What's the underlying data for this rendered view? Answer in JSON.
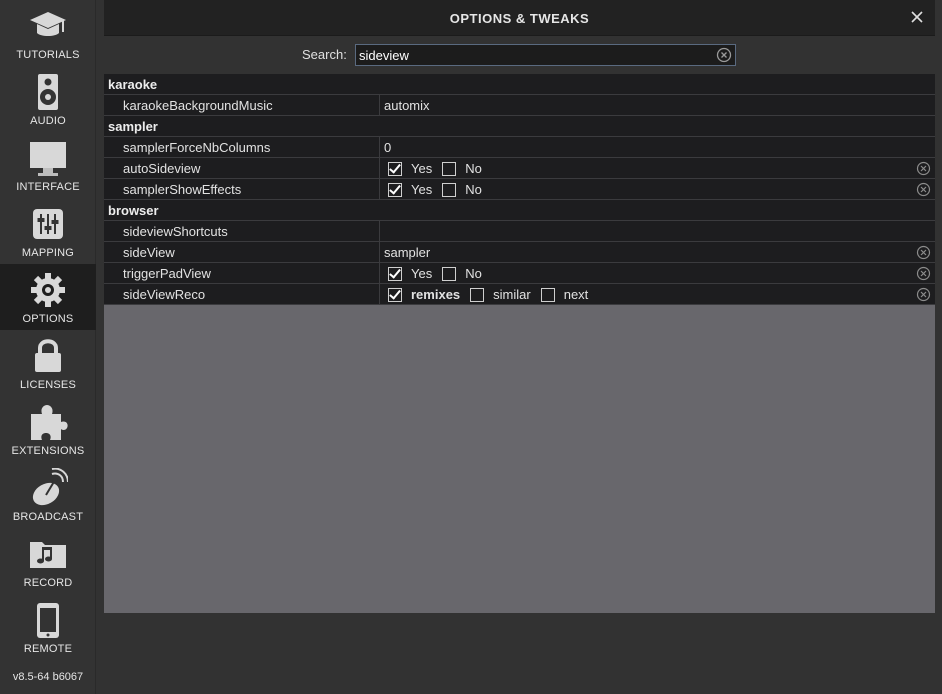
{
  "sidebar": {
    "items": [
      {
        "label": "TUTORIALS",
        "icon": "graduation-cap-icon"
      },
      {
        "label": "AUDIO",
        "icon": "speaker-icon"
      },
      {
        "label": "INTERFACE",
        "icon": "monitor-icon"
      },
      {
        "label": "MAPPING",
        "icon": "sliders-icon"
      },
      {
        "label": "OPTIONS",
        "icon": "gear-icon",
        "active": true
      },
      {
        "label": "LICENSES",
        "icon": "lock-icon"
      },
      {
        "label": "EXTENSIONS",
        "icon": "puzzle-icon"
      },
      {
        "label": "BROADCAST",
        "icon": "satellite-dish-icon"
      },
      {
        "label": "RECORD",
        "icon": "music-folder-icon"
      },
      {
        "label": "REMOTE",
        "icon": "phone-icon"
      }
    ],
    "version": "v8.5-64 b6067"
  },
  "window": {
    "title": "OPTIONS & TWEAKS",
    "close_icon": "close-icon"
  },
  "search": {
    "label": "Search:",
    "value": "sideview",
    "clear_icon": "clear-circle-icon"
  },
  "groups": [
    {
      "name": "karaoke",
      "rows": [
        {
          "key": "karaokeBackgroundMusic",
          "type": "text",
          "value": "automix",
          "reset": false
        }
      ]
    },
    {
      "name": "sampler",
      "rows": [
        {
          "key": "samplerForceNbColumns",
          "type": "text",
          "value": "0",
          "reset": false
        },
        {
          "key": "autoSideview",
          "type": "choice",
          "options": [
            {
              "label": "Yes",
              "checked": true
            },
            {
              "label": "No",
              "checked": false
            }
          ],
          "reset": true
        },
        {
          "key": "samplerShowEffects",
          "type": "choice",
          "options": [
            {
              "label": "Yes",
              "checked": true
            },
            {
              "label": "No",
              "checked": false
            }
          ],
          "reset": true
        }
      ]
    },
    {
      "name": "browser",
      "rows": [
        {
          "key": "sideviewShortcuts",
          "type": "text",
          "value": "",
          "reset": false
        },
        {
          "key": "sideView",
          "type": "text",
          "value": "sampler",
          "reset": true
        },
        {
          "key": "triggerPadView",
          "type": "choice",
          "options": [
            {
              "label": "Yes",
              "checked": true
            },
            {
              "label": "No",
              "checked": false
            }
          ],
          "reset": true
        },
        {
          "key": "sideViewReco",
          "type": "choice",
          "options": [
            {
              "label": "remixes",
              "checked": true,
              "bold": true
            },
            {
              "label": "similar",
              "checked": false
            },
            {
              "label": "next",
              "checked": false
            }
          ],
          "reset": true
        }
      ]
    }
  ],
  "colors": {
    "row_bg": "#1d1d1f",
    "panel_bg": "#68676c",
    "sidebar_active_bg": "#1e1e1e"
  }
}
